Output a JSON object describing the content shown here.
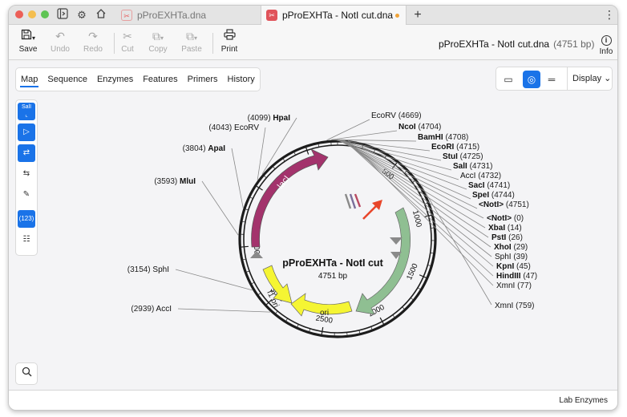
{
  "window": {
    "traffic_lights": [
      "#ec5f57",
      "#f4be4f",
      "#5fc454"
    ],
    "tabs": [
      {
        "label": "pProEXHTa.dna",
        "active": false
      },
      {
        "label": "pProEXHTa - NotI cut.dna",
        "active": true,
        "unsaved": true
      }
    ],
    "new_tab_icon": "plus-icon",
    "menu_icon": "kebab-icon"
  },
  "toolbar": {
    "save": "Save",
    "undo": "Undo",
    "redo": "Redo",
    "cut": "Cut",
    "copy": "Copy",
    "paste": "Paste",
    "print": "Print",
    "doc_title": "pProEXHTa - NotI cut.dna",
    "doc_size": "(4751 bp)",
    "info": "Info",
    "info_glyph": "i"
  },
  "view_tabs": [
    "Map",
    "Sequence",
    "Enzymes",
    "Features",
    "Primers",
    "History"
  ],
  "active_view": "Map",
  "display_menu": "Display",
  "sidebar": {
    "top_button": "SalI",
    "count_button": "(123)"
  },
  "map": {
    "name": "pProEXHTa - NotI cut",
    "length": "4751 bp",
    "ticks": [
      "500",
      "1000",
      "1500",
      "2000",
      "2500",
      "3000",
      "3500",
      "4000"
    ],
    "features": [
      {
        "label": "lacI",
        "color": "#a3336c"
      },
      {
        "label": "f1 ori",
        "color": "#f5f533"
      },
      {
        "label": "ori",
        "color": "#f5f533"
      },
      {
        "label": "",
        "color": "#8fbf92"
      }
    ],
    "sites_left": [
      {
        "name": "HpaI",
        "pos": "(4099)",
        "bold": true
      },
      {
        "name": "EcoRV",
        "pos": "(4043)",
        "bold": false
      },
      {
        "name": "ApaI",
        "pos": "(3804)",
        "bold": true
      },
      {
        "name": "MluI",
        "pos": "(3593)",
        "bold": true
      },
      {
        "name": "SphI",
        "pos": "(3154)",
        "bold": false
      },
      {
        "name": "AccI",
        "pos": "(2939)",
        "bold": false
      }
    ],
    "sites_top": [
      {
        "name": "EcoRV",
        "pos": "(4669)",
        "bold": false
      },
      {
        "name": "NcoI",
        "pos": "(4704)",
        "bold": true
      },
      {
        "name": "BamHI",
        "pos": "(4708)",
        "bold": true
      },
      {
        "name": "EcoRI",
        "pos": "(4715)",
        "bold": true
      },
      {
        "name": "StuI",
        "pos": "(4725)",
        "bold": true
      },
      {
        "name": "SalI",
        "pos": "(4731)",
        "bold": true
      },
      {
        "name": "AccI",
        "pos": "(4732)",
        "bold": false
      },
      {
        "name": "SacI",
        "pos": "(4741)",
        "bold": true
      },
      {
        "name": "SpeI",
        "pos": "(4744)",
        "bold": true
      },
      {
        "name": "<NotI>",
        "pos": "(4751)",
        "bold": true
      }
    ],
    "sites_right": [
      {
        "name": "<NotI>",
        "pos": "(0)",
        "bold": true
      },
      {
        "name": "XbaI",
        "pos": "(14)",
        "bold": true
      },
      {
        "name": "PstI",
        "pos": "(26)",
        "bold": true
      },
      {
        "name": "XhoI",
        "pos": "(29)",
        "bold": true
      },
      {
        "name": "SphI",
        "pos": "(39)",
        "bold": false
      },
      {
        "name": "KpnI",
        "pos": "(45)",
        "bold": true
      },
      {
        "name": "HindIII",
        "pos": "(47)",
        "bold": true
      },
      {
        "name": "XmnI",
        "pos": "(77)",
        "bold": false
      }
    ],
    "site_far": {
      "name": "XmnI",
      "pos": "(759)",
      "bold": false
    }
  },
  "status": "Lab Enzymes"
}
